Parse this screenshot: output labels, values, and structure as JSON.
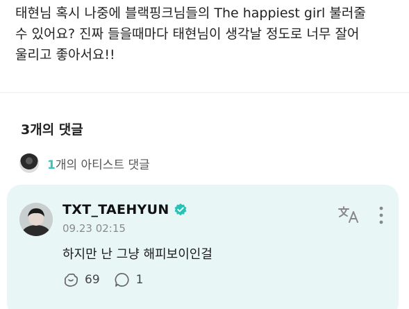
{
  "post": {
    "text": "태현님 혹시 나중에 블랙핑크님들의 The happiest girl 불러줄\n수 있어요? 진짜 들을때마다 태현님이 생각날 정도로 너무 잘어\n울리고 좋아서요!!"
  },
  "comments": {
    "count_label": "3개의 댓글",
    "artist_count": "1",
    "artist_label": "개의 아티스트 댓글"
  },
  "artist_comment": {
    "author": "TXT_TAEHYUN",
    "timestamp": "09.23 02:15",
    "text": "하지만 난 그냥 해피보이인걸",
    "likes": "69",
    "replies": "1"
  },
  "colors": {
    "accent": "#3ec1b6",
    "card_background": "#e8f7f5",
    "verified": "#27c2b5"
  },
  "icons": {
    "verified": "verified-badge-icon",
    "translate": "translate-icon",
    "more": "more-vertical-icon",
    "like": "like-icon",
    "reply": "reply-icon"
  }
}
